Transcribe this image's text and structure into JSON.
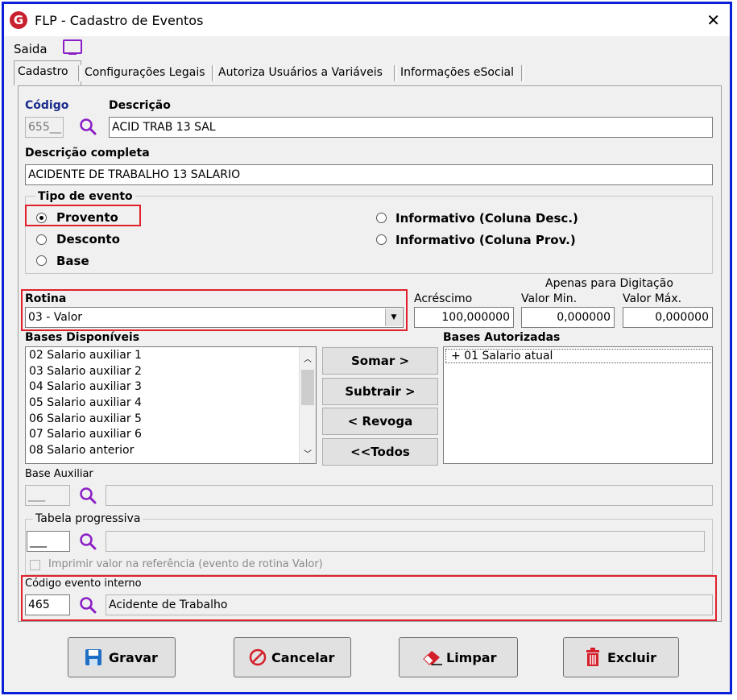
{
  "window": {
    "title": "FLP - Cadastro de Eventos",
    "logo_letter": "G",
    "close_symbol": "✕"
  },
  "menu": {
    "saida": "Saida"
  },
  "tabs": [
    "Cadastro",
    "Configurações Legais",
    "Autoriza Usuários a Variáveis",
    "Informações eSocial"
  ],
  "codigo": {
    "label": "Código",
    "value": "655__"
  },
  "descricao": {
    "label": "Descrição",
    "value": "ACID TRAB 13 SAL"
  },
  "descricao_completa": {
    "label": "Descrição completa",
    "value": "ACIDENTE DE TRABALHO 13 SALARIO"
  },
  "tipo_evento": {
    "label": "Tipo de evento",
    "options": [
      "Provento",
      "Desconto",
      "Base",
      "Informativo (Coluna Desc.)",
      "Informativo (Coluna Prov.)"
    ],
    "selected": "Provento"
  },
  "rotina": {
    "label": "Rotina",
    "value": "03 - Valor"
  },
  "digitacao": {
    "header": "Apenas para Digitação",
    "acrescimo": {
      "label": "Acréscimo",
      "value": "100,000000"
    },
    "valor_min": {
      "label": "Valor Min.",
      "value": "0,000000"
    },
    "valor_max": {
      "label": "Valor Máx.",
      "value": "0,000000"
    }
  },
  "bases_disponiveis": {
    "label": "Bases Disponíveis",
    "items": [
      "02 Salario auxiliar 1",
      "03 Salario auxiliar 2",
      "04 Salario auxiliar 3",
      "05 Salario auxiliar 4",
      "06 Salario auxiliar 5",
      "07 Salario auxiliar 6",
      "08 Salario anterior"
    ]
  },
  "actions": {
    "somar": "Somar >",
    "subtrair": "Subtrair >",
    "revoga": "< Revoga",
    "todos": "<<Todos"
  },
  "bases_autorizadas": {
    "label": "Bases Autorizadas",
    "items": [
      "+ 01 Salario atual"
    ]
  },
  "base_auxiliar": {
    "label": "Base Auxiliar",
    "code": "___",
    "desc": ""
  },
  "tabela_progressiva": {
    "label": "Tabela progressiva",
    "code": "___",
    "desc": ""
  },
  "imprimir": {
    "label": "Imprimir valor na referência (evento de rotina Valor)"
  },
  "codigo_interno": {
    "label": "Código evento interno",
    "code": "465",
    "desc": "Acidente de Trabalho"
  },
  "buttons": {
    "gravar": "Gravar",
    "cancelar": "Cancelar",
    "limpar": "Limpar",
    "excluir": "Excluir"
  },
  "colors": {
    "accent_border": "#0a1fd8",
    "highlight": "#e0212b",
    "icon_purple": "#8b1ec4",
    "logo_red": "#c8202f"
  }
}
